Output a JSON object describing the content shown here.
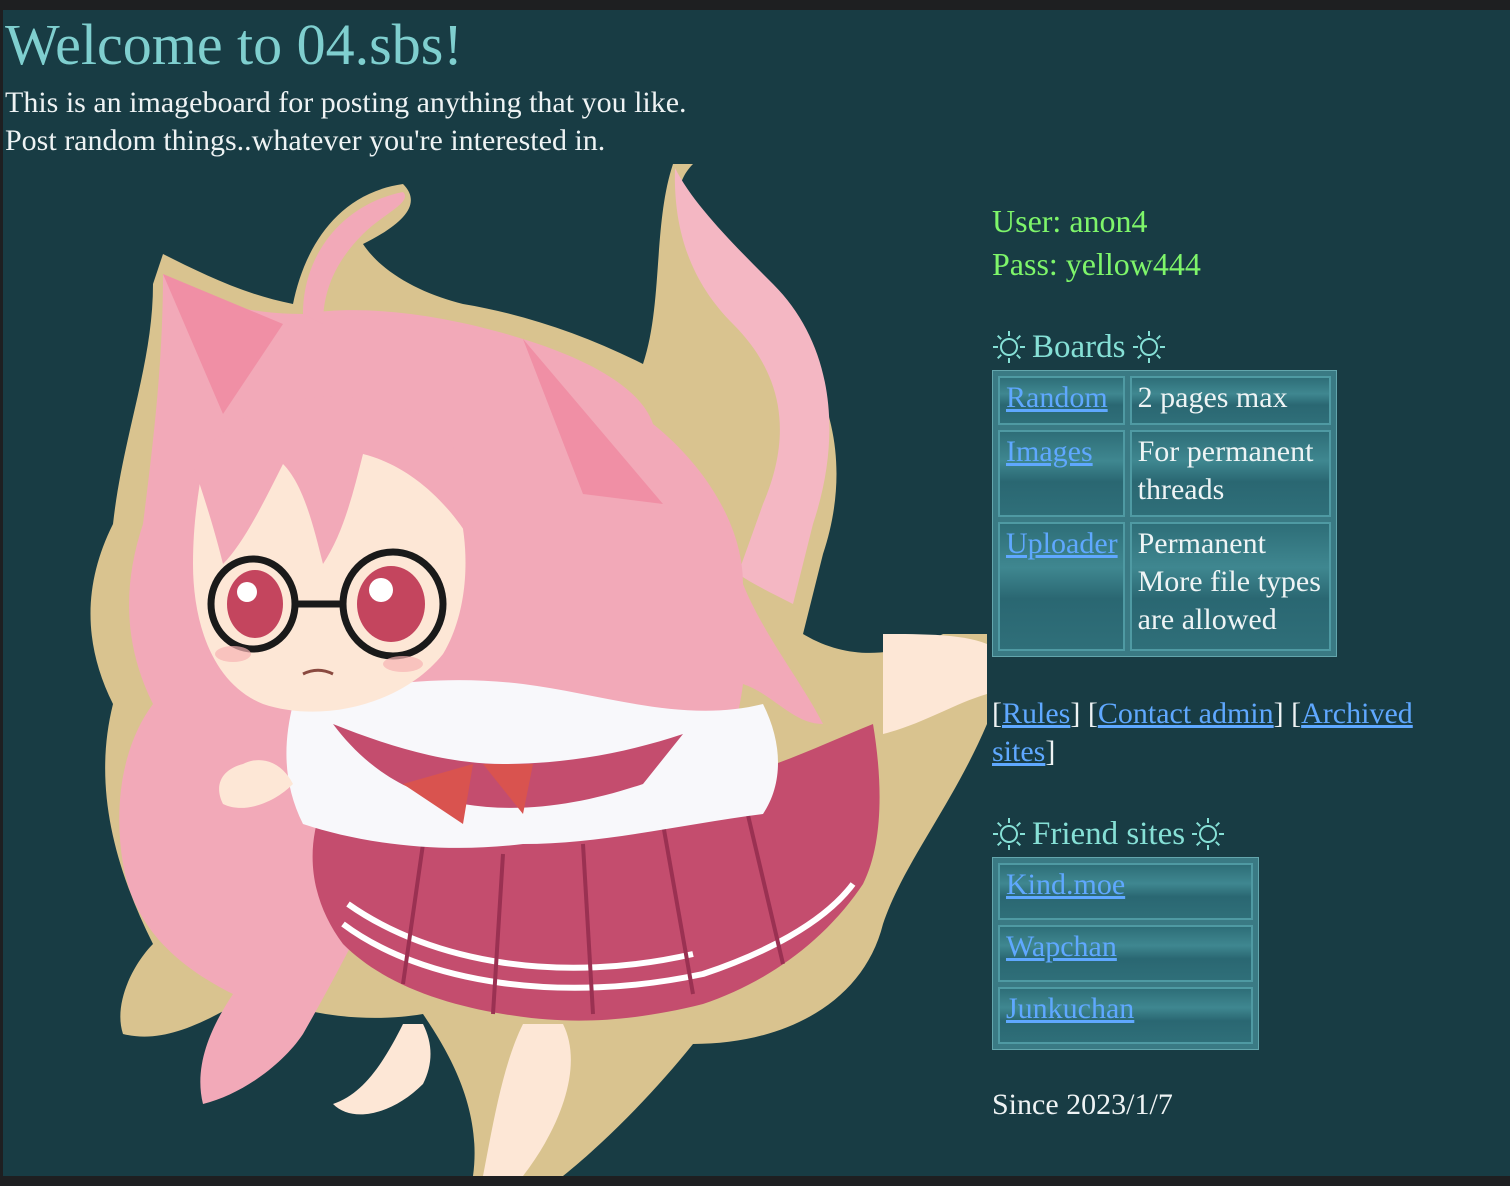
{
  "header": {
    "title": "Welcome to 04.sbs!",
    "intro_line1": "This is an imageboard for posting anything that you like.",
    "intro_line2": "Post random things..whatever you're interested in."
  },
  "credentials": {
    "user": "User: anon4",
    "pass": "Pass: yellow444"
  },
  "boards": {
    "heading": "Boards",
    "icon": "sun-icon",
    "rows": [
      {
        "name": "Random",
        "desc": "2 pages max"
      },
      {
        "name": "Images",
        "desc": "For permanent threads"
      },
      {
        "name": "Uploader",
        "desc": "Permanent More file types are allowed"
      }
    ]
  },
  "links": {
    "rules": "Rules",
    "contact": "Contact admin",
    "archived": "Archived sites",
    "open": "[",
    "close": "]"
  },
  "friends": {
    "heading": "Friend sites",
    "items": [
      "Kind.moe",
      "Wapchan",
      "Junkuchan"
    ]
  },
  "footer": {
    "since": "Since 2023/1/7"
  },
  "illustration": {
    "alt": "catgirl-illustration",
    "colors": {
      "hair": "#f2a9b8",
      "skirt": "#c44d6e",
      "outline": "#d9c38f",
      "skin": "#fde7d6"
    }
  }
}
